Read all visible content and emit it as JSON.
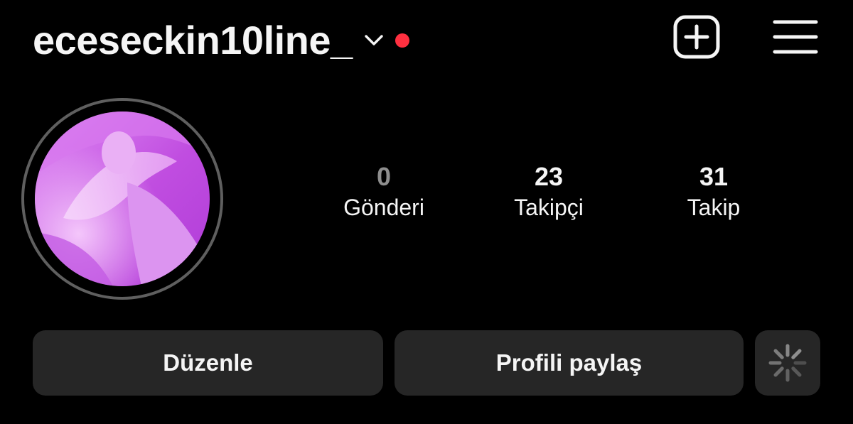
{
  "header": {
    "username": "eceseckin10line_",
    "chevron_icon": "chevron-down-icon",
    "notification_dot_color": "#ff3040",
    "new_post_icon": "plus-square-icon",
    "menu_icon": "hamburger-menu-icon"
  },
  "profile": {
    "avatar_description_icon": "profile-photo",
    "avatar_tint": "#c64fe6"
  },
  "stats": {
    "posts": {
      "value": "0",
      "label": "Gönderi"
    },
    "followers": {
      "value": "23",
      "label": "Takipçi"
    },
    "following": {
      "value": "31",
      "label": "Takip"
    }
  },
  "actions": {
    "edit_label": "Düzenle",
    "share_label": "Profili paylaş",
    "discover_icon": "loading-spinner-icon"
  },
  "colors": {
    "background": "#000000",
    "button_bg": "#262626",
    "text": "#f5f5f5",
    "muted_text": "#8e8e8e",
    "ring": "#5f5f5f"
  }
}
